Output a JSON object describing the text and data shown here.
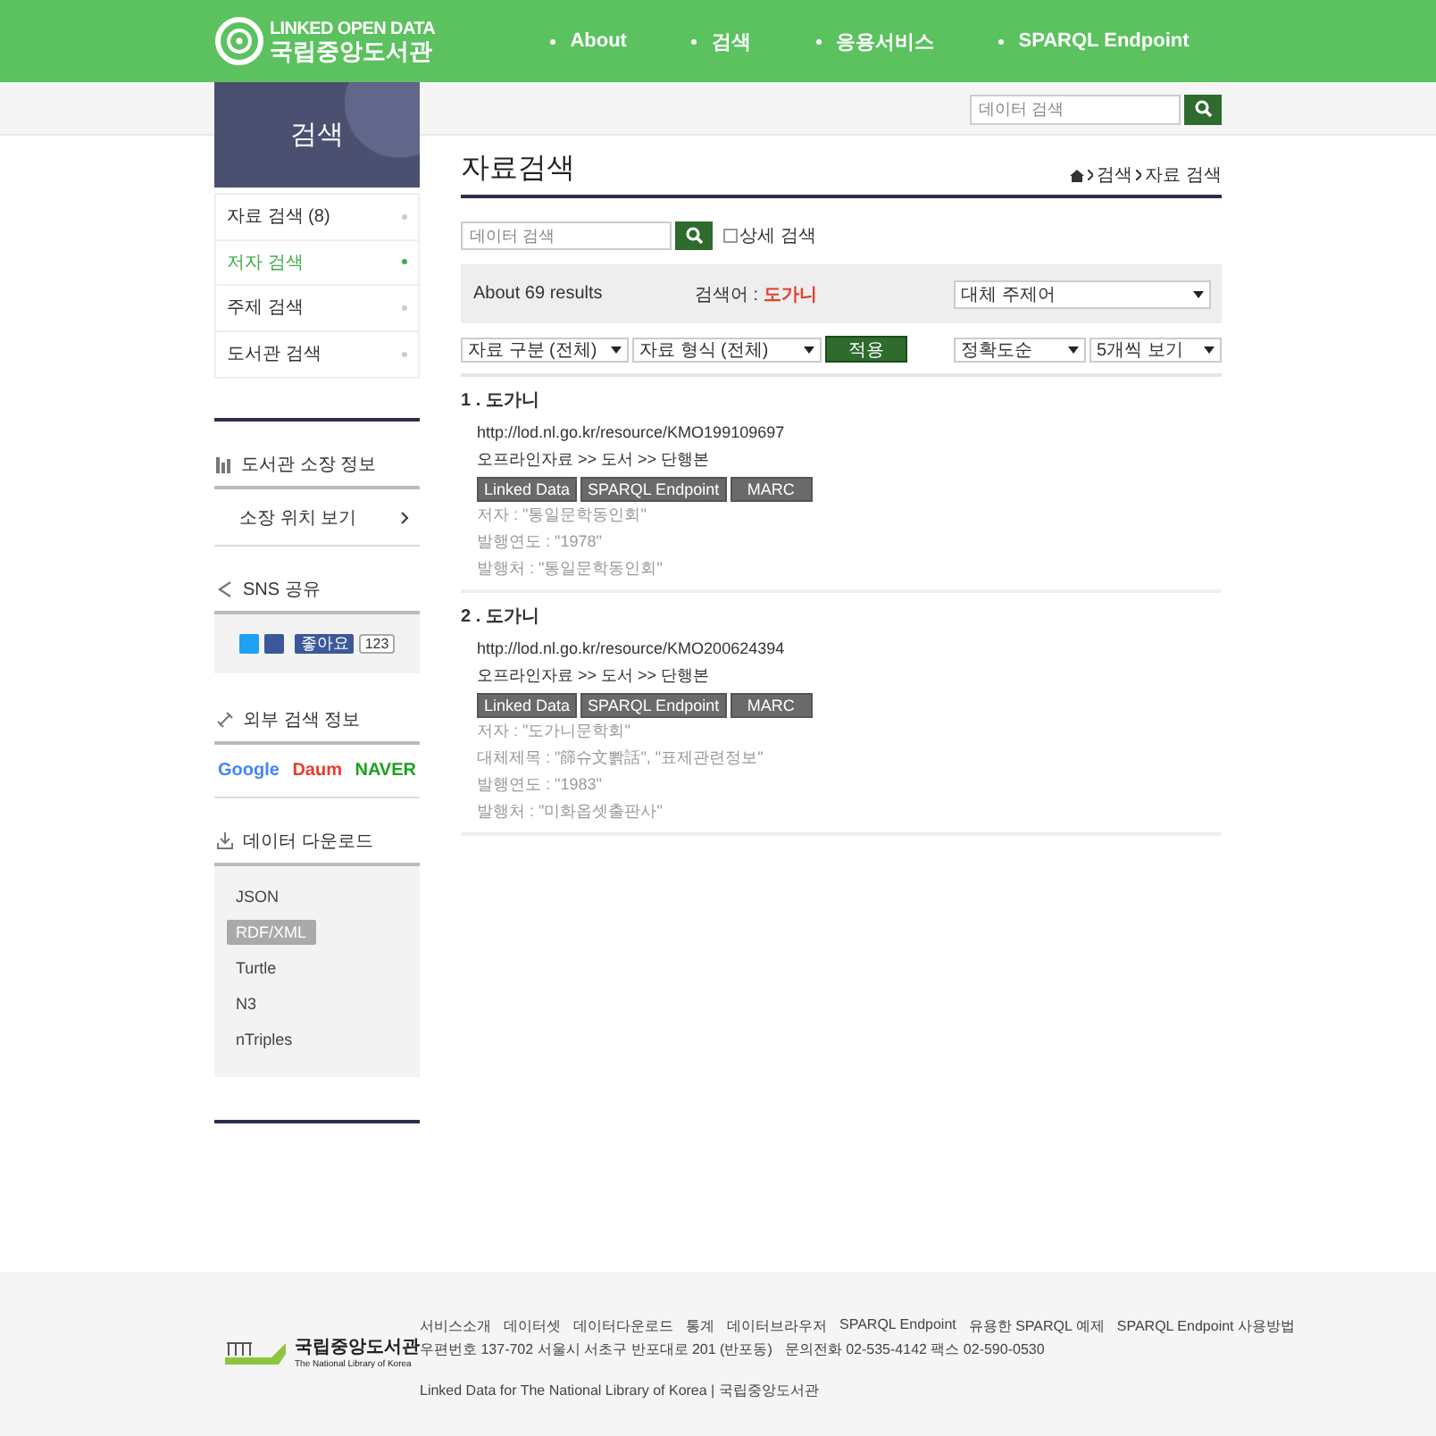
{
  "header": {
    "logo": {
      "line1": "LINKED OPEN DATA",
      "line2": "국립중앙도서관"
    },
    "nav": [
      {
        "label": "About"
      },
      {
        "label": "검색"
      },
      {
        "label": "응용서비스"
      },
      {
        "label": "SPARQL Endpoint"
      }
    ]
  },
  "top_search": {
    "placeholder": "데이터 검색"
  },
  "sidebar": {
    "title": "검색",
    "menu": [
      {
        "label": "자료 검색 (8)",
        "selected": false
      },
      {
        "label": "저자 검색",
        "selected": true
      },
      {
        "label": "주제 검색",
        "selected": false
      },
      {
        "label": "도서관 검색",
        "selected": false
      }
    ],
    "holdings": {
      "title": "도서관 소장 정보",
      "link": "소장 위치 보기"
    },
    "sns": {
      "title": "SNS 공유",
      "like_label": "좋아요",
      "like_count": "123"
    },
    "external": {
      "title": "외부 검색 정보",
      "engines": [
        {
          "kind": "google",
          "label": "Google"
        },
        {
          "kind": "daum",
          "label": "Daum"
        },
        {
          "kind": "naver",
          "label": "NAVER"
        }
      ]
    },
    "download": {
      "title": "데이터 다운로드",
      "formats": [
        {
          "label": "JSON",
          "selected": false
        },
        {
          "label": "RDF/XML",
          "selected": true
        },
        {
          "label": "Turtle",
          "selected": false
        },
        {
          "label": "N3",
          "selected": false
        },
        {
          "label": "nTriples",
          "selected": false
        }
      ]
    }
  },
  "main": {
    "title": "자료검색",
    "breadcrumb": [
      "검색",
      "자료 검색"
    ],
    "search": {
      "placeholder": "데이터 검색"
    },
    "detail_search": {
      "label": "상세 검색",
      "checked": false
    },
    "summary": {
      "count": "About 69 results",
      "query_label": "검색어 :",
      "query": "도가니",
      "subject_select": "대체 주제어"
    },
    "filters": {
      "type_select": "자료 구분 (전체)",
      "format_select": "자료 형식 (전체)",
      "apply": "적용",
      "sort_select": "정확도순",
      "page_size_select": "5개씩 보기"
    },
    "results": [
      {
        "title": "1 . 도가니",
        "uri": "http://lod.nl.go.kr/resource/KMO199109697",
        "category": "오프라인자료 >> 도서 >> 단행본",
        "buttons": [
          "Linked Data",
          "SPARQL Endpoint",
          "MARC"
        ],
        "fields": [
          "저자 : \"통일문학동인회\"",
          "발행연도 : \"1978\"",
          "발행처 : \"통일문학동인회\""
        ]
      },
      {
        "title": "2 . 도가니",
        "uri": "http://lod.nl.go.kr/resource/KMO200624394",
        "category": "오프라인자료 >> 도서 >> 단행본",
        "buttons": [
          "Linked Data",
          "SPARQL Endpoint",
          "MARC"
        ],
        "fields": [
          "저자 : \"도가니문학회\"",
          "대체제목 : \"篩슈文뽥話\", \"표제관련정보\"",
          "발행연도 : \"1983\"",
          "발행처 : \"미화옵셋출판사\""
        ]
      }
    ]
  },
  "footer": {
    "logo": {
      "name": "국립중앙도서관",
      "sub": "The National Library of Korea"
    },
    "links": [
      "서비스소개",
      "데이터셋",
      "데이터다운로드",
      "통계",
      "데이터브라우저",
      "SPARQL Endpoint",
      "유용한 SPARQL 예제",
      "SPARQL Endpoint 사용방법"
    ],
    "address": "우편번호 137-702 서울시 서초구 반포대로 201 (반포동)",
    "contact": "문의전화 02-535-4142 팩스 02-590-0530",
    "copyright": "Linked Data for The National Library of Korea | 국립중앙도서관"
  }
}
